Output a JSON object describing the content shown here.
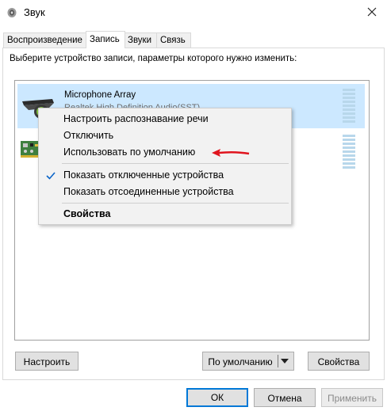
{
  "window": {
    "title": "Звук",
    "tabs": [
      {
        "label": "Воспроизведение"
      },
      {
        "label": "Запись"
      },
      {
        "label": "Звуки"
      },
      {
        "label": "Связь"
      }
    ],
    "active_tab": "Запись"
  },
  "recording": {
    "instructions": "Выберите устройство записи, параметры которого нужно изменить:",
    "devices": [
      {
        "name": "Microphone Array",
        "subtitle": "Realtek High Definition Audio(SST)",
        "icon": "microphone-array-icon",
        "selected": true
      },
      {
        "name": "",
        "subtitle": "",
        "icon": "sound-card-icon",
        "selected": false
      }
    ]
  },
  "context_menu": {
    "items": [
      {
        "label": "Настроить распознавание речи"
      },
      {
        "label": "Отключить"
      },
      {
        "label": "Использовать по умолчанию"
      },
      {
        "label": "Показать отключенные устройства",
        "checked": true
      },
      {
        "label": "Показать отсоединенные устройства"
      },
      {
        "label": "Свойства",
        "bold": true
      }
    ]
  },
  "buttons": {
    "configure": "Настроить",
    "set_default": "По умолчанию",
    "properties": "Свойства",
    "ok": "ОК",
    "cancel": "Отмена",
    "apply": "Применить"
  },
  "colors": {
    "selection": "#cce8ff",
    "accent": "#0078d7",
    "annotation_arrow": "#e0141e",
    "level_meter": "#b8d7eb"
  }
}
